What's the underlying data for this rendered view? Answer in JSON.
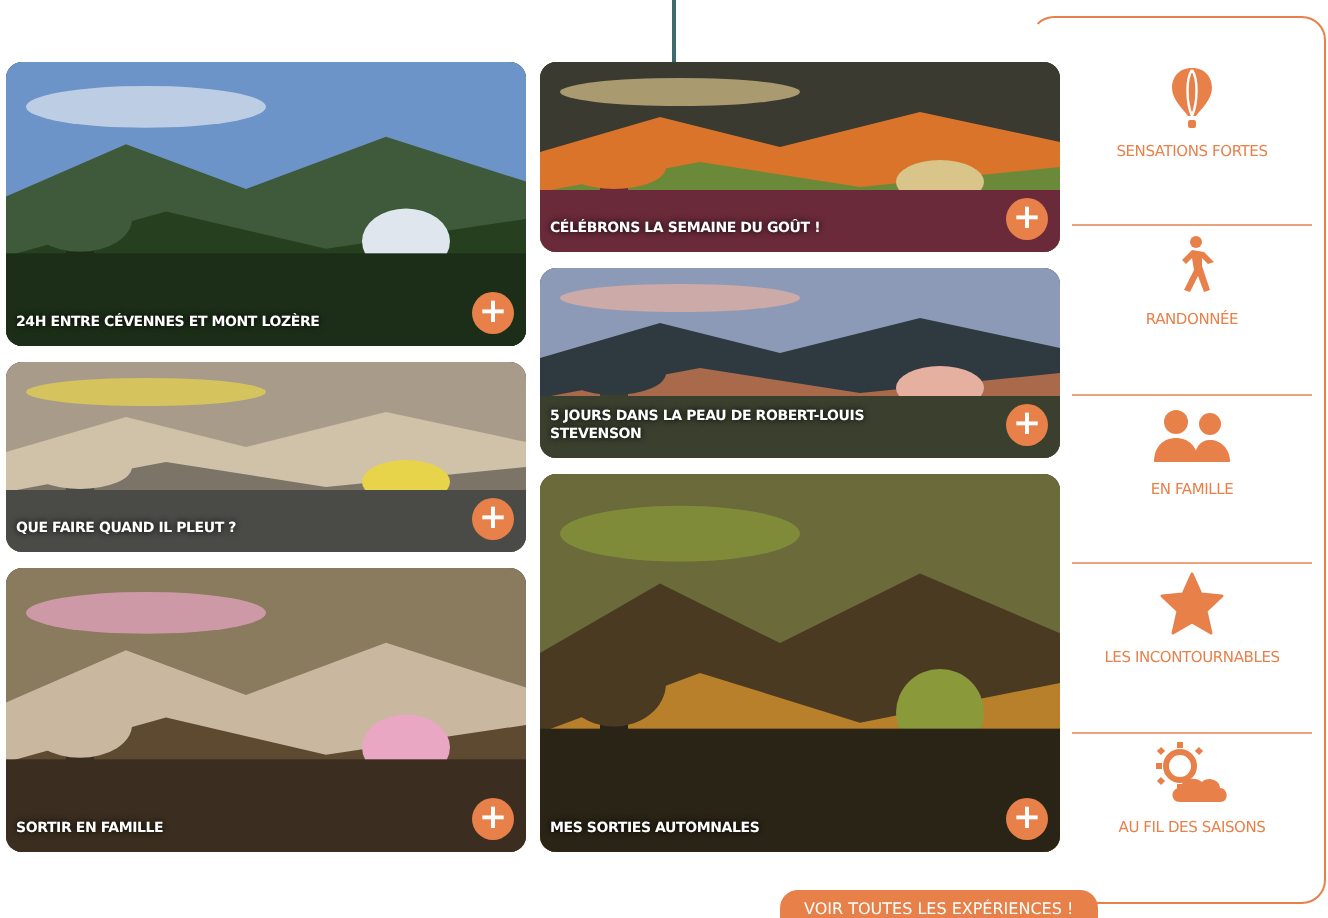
{
  "columns": [
    {
      "cards": [
        {
          "title": "24H ENTRE CÉVENNES ET MONT LOZÈRE",
          "more": "+"
        },
        {
          "title": "QUE FAIRE QUAND IL PLEUT ?",
          "more": "+"
        },
        {
          "title": "SORTIR EN FAMILLE",
          "more": "+"
        }
      ]
    },
    {
      "cards": [
        {
          "title": "CÉLÉBRONS LA SEMAINE DU GOÛT !",
          "more": "+"
        },
        {
          "title": "5 JOURS DANS LA PEAU DE ROBERT-LOUIS STEVENSON",
          "more": "+"
        },
        {
          "title": "MES SORTIES AUTOMNALES",
          "more": "+"
        }
      ]
    }
  ],
  "categories": [
    {
      "label": "SENSATIONS FORTES",
      "kind": "balloon"
    },
    {
      "label": "RANDONNÉE",
      "kind": "hiker"
    },
    {
      "label": "EN FAMILLE",
      "kind": "family"
    },
    {
      "label": "LES INCONTOURNABLES",
      "kind": "star"
    },
    {
      "label": "AU FIL DES SAISONS",
      "kind": "weather"
    }
  ],
  "see_all_button": "VOIR TOUTES LES EXPÉRIENCES !"
}
